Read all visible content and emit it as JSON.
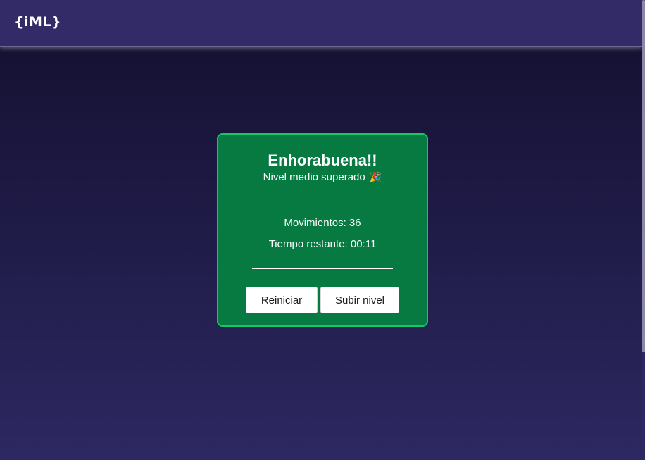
{
  "header": {
    "logo": "{iML}"
  },
  "dialog": {
    "title": "Enhorabuena!!",
    "subtitle": "Nivel medio superado",
    "subtitle_emoji": "🎉",
    "moves_label": "Movimientos: 36",
    "time_label": "Tiempo restante: 00:11",
    "restart_label": "Reiniciar",
    "next_level_label": "Subir nivel"
  },
  "colors": {
    "header_bg": "#322b68",
    "dialog_bg": "#077a42",
    "dialog_border": "#1bc469"
  }
}
